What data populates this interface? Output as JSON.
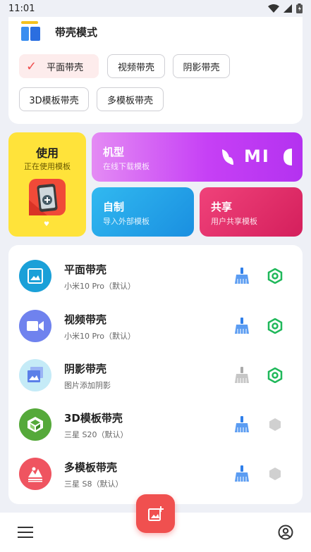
{
  "status_bar": {
    "time": "11:01"
  },
  "mode_section": {
    "title": "带壳模式",
    "options": [
      {
        "label": "平面带壳",
        "selected": true
      },
      {
        "label": "视频带壳",
        "selected": false
      },
      {
        "label": "阴影带壳",
        "selected": false
      },
      {
        "label": "3D模板带壳",
        "selected": false
      },
      {
        "label": "多模板带壳",
        "selected": false
      }
    ]
  },
  "tiles": {
    "use": {
      "title": "使用",
      "subtitle": "正在使用模板"
    },
    "model": {
      "title": "机型",
      "subtitle": "在线下载模板",
      "brand_logo": "MI"
    },
    "self": {
      "title": "自制",
      "subtitle": "导入外部模板"
    },
    "share": {
      "title": "共享",
      "subtitle": "用户共享模板"
    }
  },
  "templates": [
    {
      "title": "平面带壳",
      "subtitle": "小米10 Pro（默认）",
      "icon": "image-icon",
      "color": "#1aa0d8",
      "active": true
    },
    {
      "title": "视频带壳",
      "subtitle": "小米10 Pro（默认）",
      "icon": "video-icon",
      "color": "#6f82ee",
      "active": true
    },
    {
      "title": "阴影带壳",
      "subtitle": "图片添加阴影",
      "icon": "gallery-icon",
      "color": "#c5ebf7",
      "active": true
    },
    {
      "title": "3D模板带壳",
      "subtitle": "三星 S20（默认）",
      "icon": "cube-icon",
      "color": "#55a93a",
      "active": false
    },
    {
      "title": "多模板带壳",
      "subtitle": "三星 S8（默认）",
      "icon": "multi-image-icon",
      "color": "#ef5460",
      "active": false
    }
  ],
  "colors": {
    "accent": "#f0504f",
    "brush_active": "#2f7fea",
    "brush_inactive": "#bdbdbd",
    "hex_active": "#1fb85a",
    "hex_inactive": "#cccccc"
  }
}
